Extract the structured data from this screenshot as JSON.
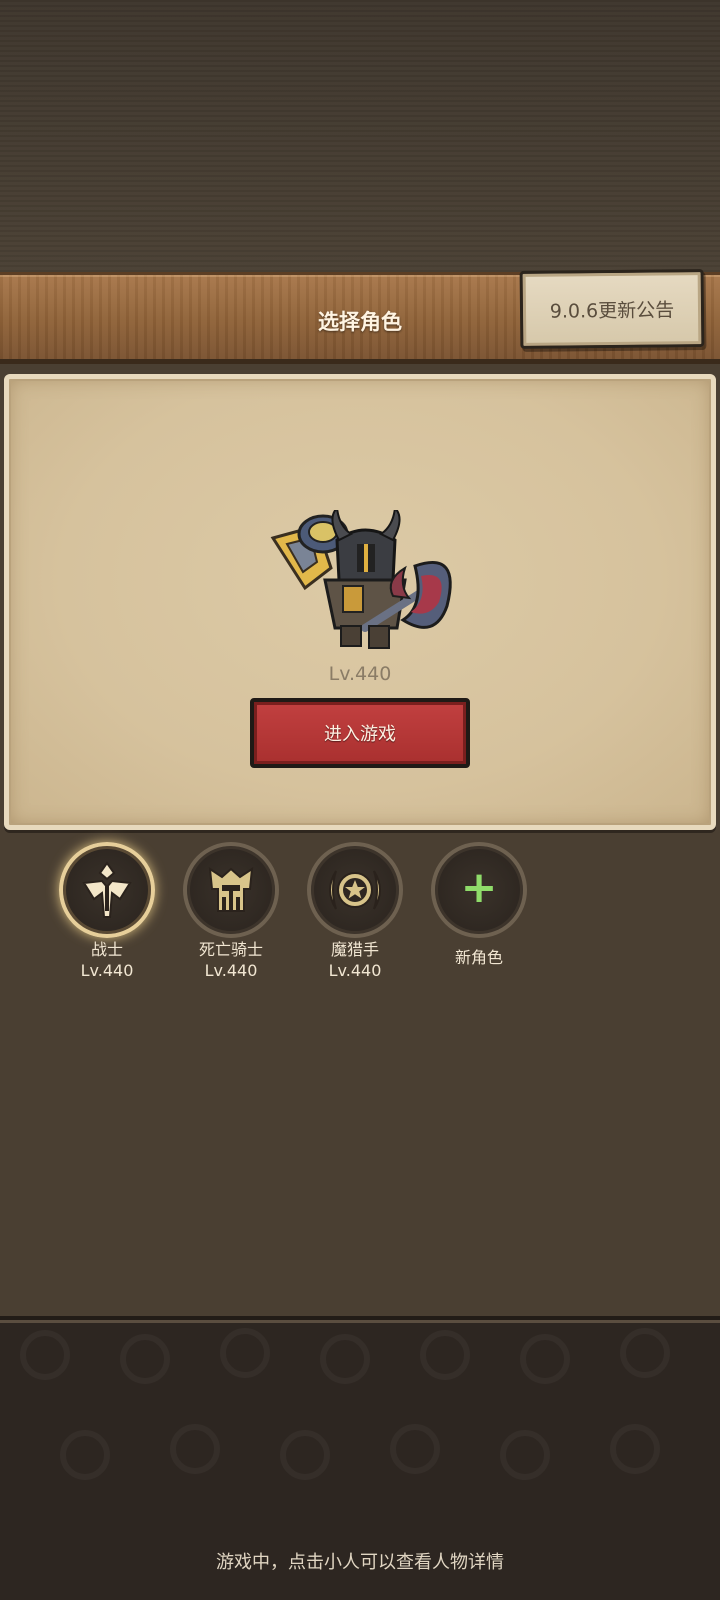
{
  "header": {
    "title": "选择角色",
    "notice_button": "9.0.6更新公告"
  },
  "hero": {
    "level": "Lv.440",
    "enter_button": "进入游戏"
  },
  "characters": [
    {
      "name": "战士",
      "level": "Lv.440",
      "icon": "sword-emblem-icon",
      "selected": true
    },
    {
      "name": "死亡骑士",
      "level": "Lv.440",
      "icon": "helmet-emblem-icon",
      "selected": false
    },
    {
      "name": "魔猎手",
      "level": "Lv.440",
      "icon": "star-moon-emblem-icon",
      "selected": false
    }
  ],
  "new_character": {
    "label": "新角色",
    "icon": "plus-icon"
  },
  "footer": {
    "hint": "游戏中，点击小人可以查看人物详情"
  },
  "colors": {
    "enter_button": "#b83a39",
    "plus": "#8fdc6a",
    "selected_ring": "#e7cf9a"
  }
}
